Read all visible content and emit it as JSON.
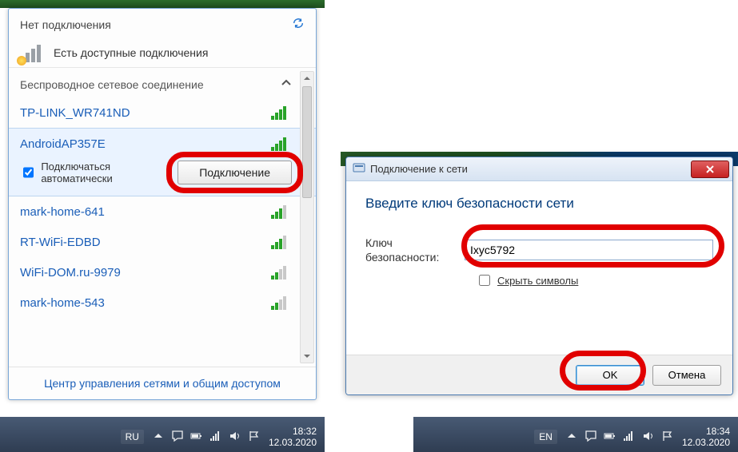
{
  "flyout": {
    "no_connection": "Нет подключения",
    "available": "Есть доступные подключения",
    "wireless_title": "Беспроводное сетевое соединение",
    "networks": [
      {
        "ssid": "TP-LINK_WR741ND",
        "strength": "full"
      },
      {
        "ssid": "AndroidAP357E",
        "strength": "full",
        "selected": true
      },
      {
        "ssid": "mark-home-641",
        "strength": "mid"
      },
      {
        "ssid": "RT-WiFi-EDBD",
        "strength": "mid"
      },
      {
        "ssid": "WiFi-DOM.ru-9979",
        "strength": "mid"
      },
      {
        "ssid": "mark-home-543",
        "strength": "low"
      }
    ],
    "auto_connect": "Подключаться автоматически",
    "auto_connect_checked": true,
    "connect_btn": "Подключение",
    "footer_link": "Центр управления сетями и общим доступом"
  },
  "dialog": {
    "title": "Подключение к сети",
    "heading": "Введите ключ безопасности сети",
    "key_label": "Ключ безопасности:",
    "key_value": "Ixyc5792",
    "hide_chars": "Скрыть символы",
    "hide_chars_checked": false,
    "ok": "OK",
    "cancel": "Отмена"
  },
  "taskbar_left": {
    "lang": "RU",
    "time": "18:32",
    "date": "12.03.2020"
  },
  "taskbar_right": {
    "lang": "EN",
    "time": "18:34",
    "date": "12.03.2020"
  }
}
